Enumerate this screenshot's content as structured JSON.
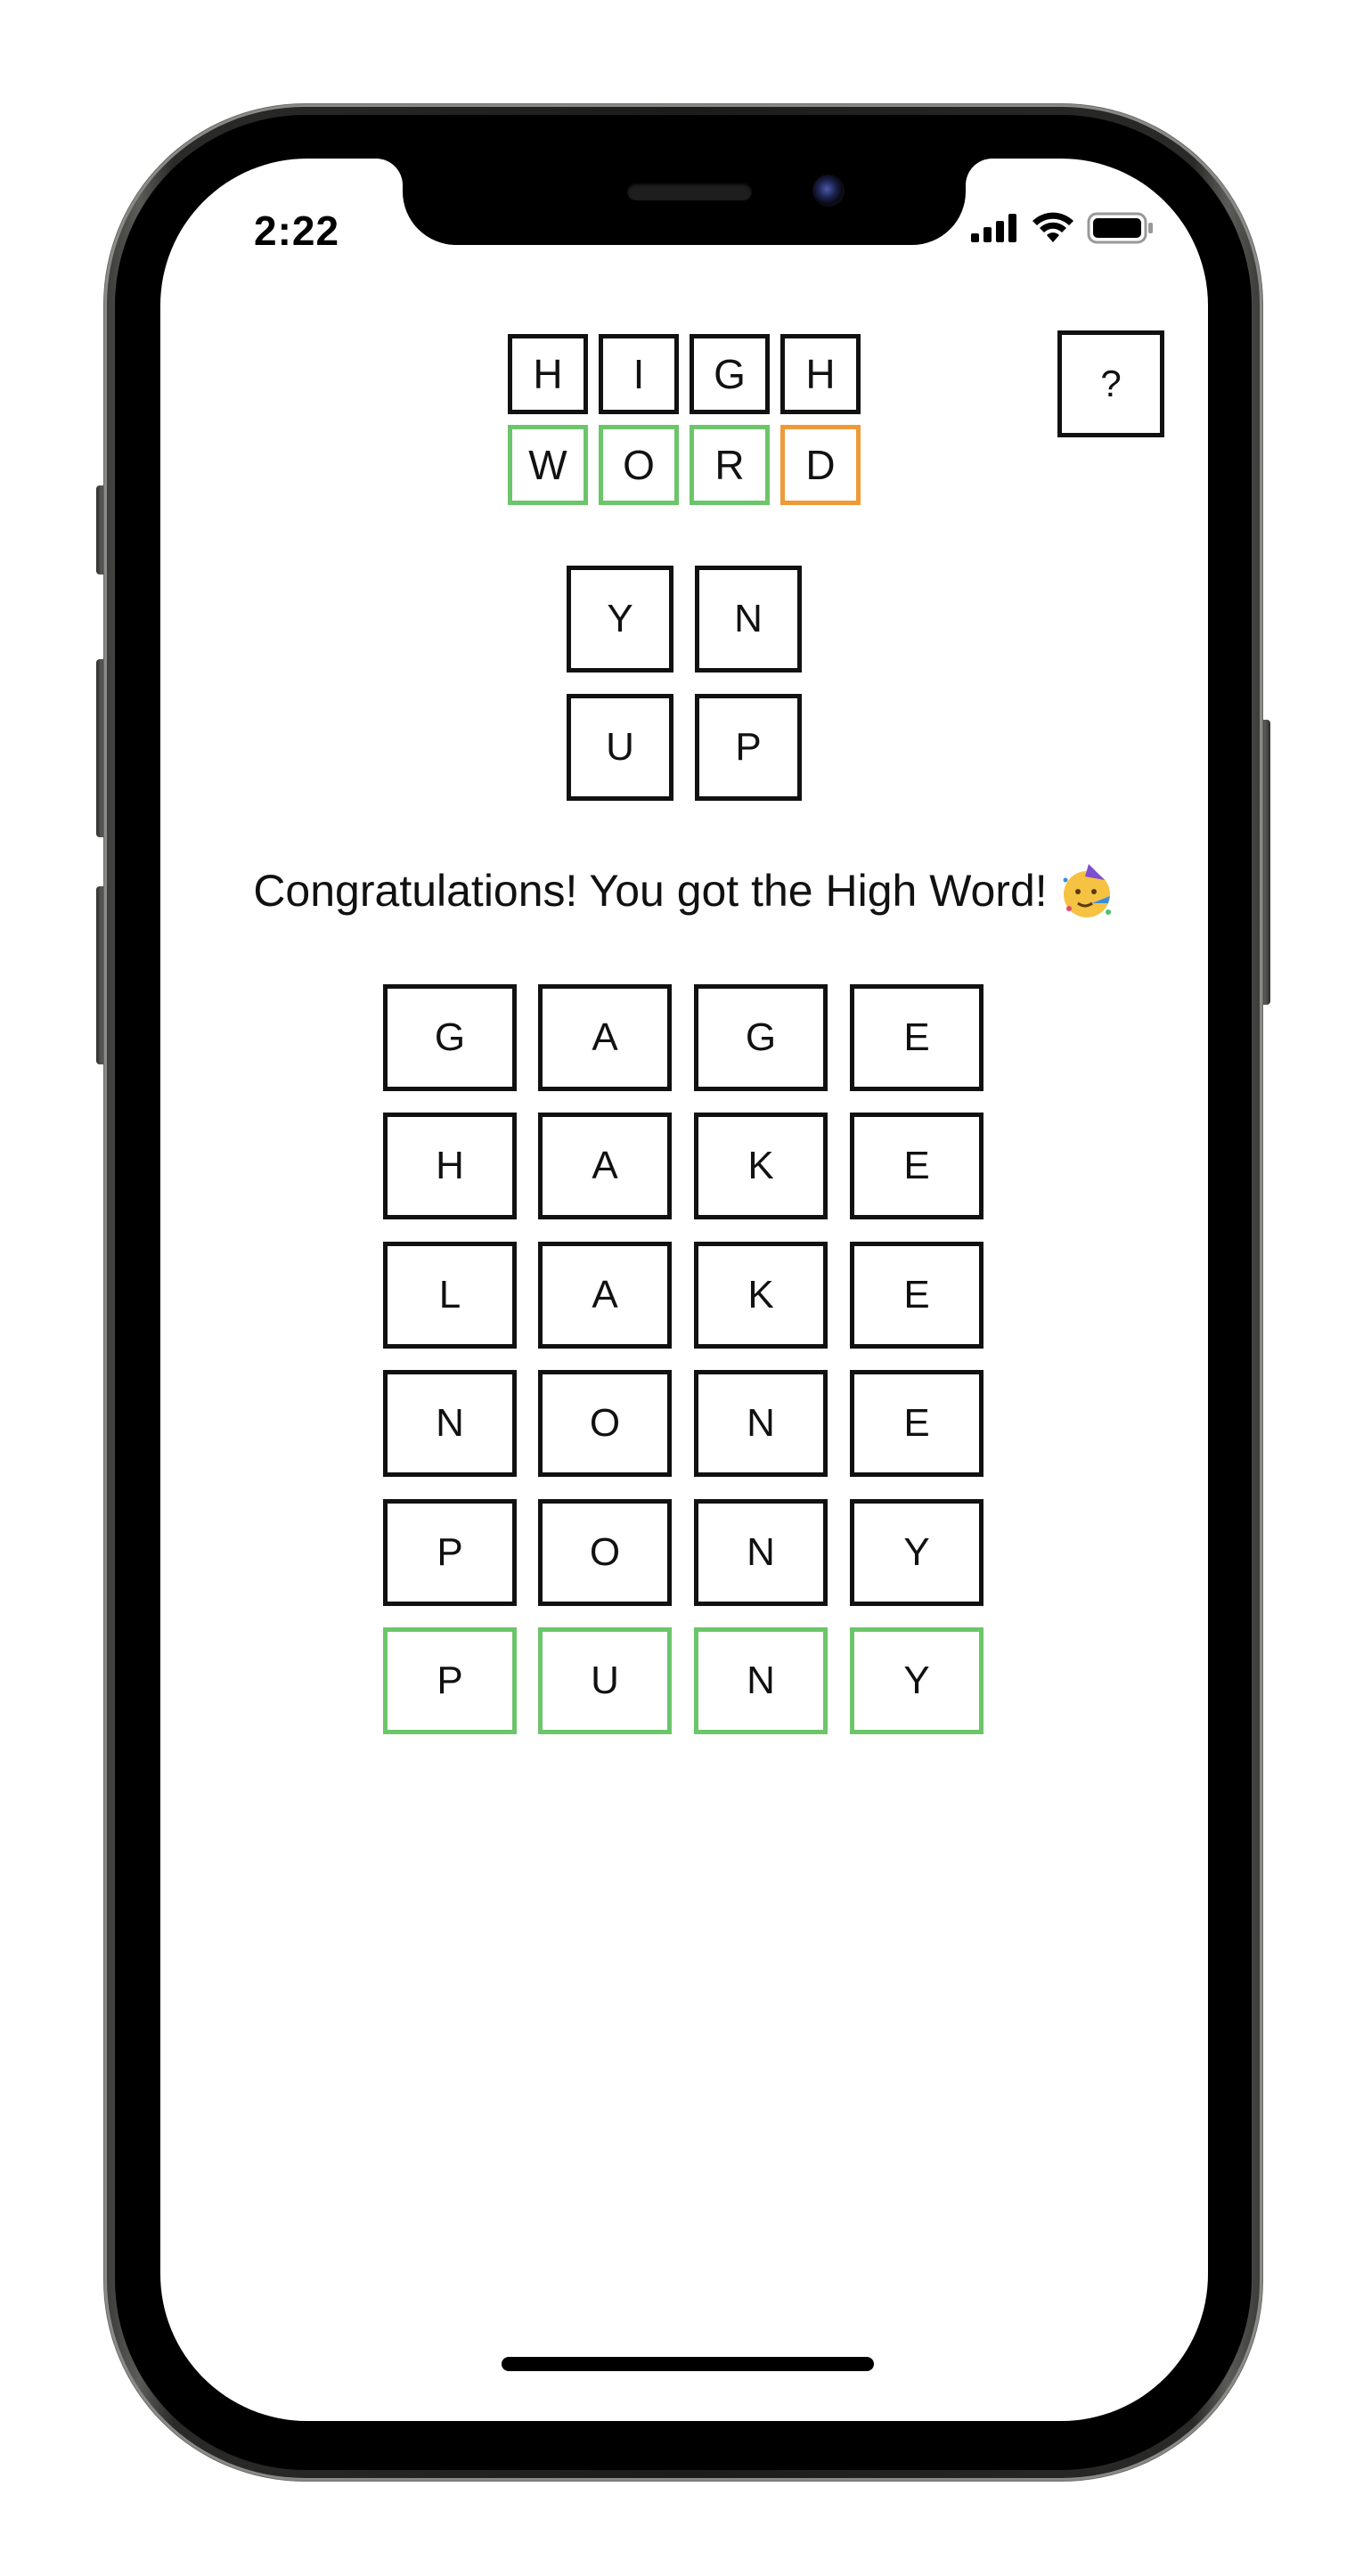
{
  "status_bar": {
    "time": "2:22",
    "icons": [
      "cellular-signal-icon",
      "wifi-icon",
      "battery-icon"
    ]
  },
  "logo": {
    "row1": [
      "H",
      "I",
      "G",
      "H"
    ],
    "row2": [
      {
        "letter": "W",
        "color": "green"
      },
      {
        "letter": "O",
        "color": "green"
      },
      {
        "letter": "R",
        "color": "green"
      },
      {
        "letter": "D",
        "color": "orange"
      }
    ]
  },
  "help_button": {
    "label": "?"
  },
  "key_grid": {
    "rows": [
      [
        "Y",
        "N"
      ],
      [
        "U",
        "P"
      ]
    ]
  },
  "message": {
    "text": "Congratulations! You got the High Word!",
    "emoji": "party-face-icon"
  },
  "guesses": {
    "rows": [
      {
        "letters": [
          "G",
          "A",
          "G",
          "E"
        ],
        "state": "default"
      },
      {
        "letters": [
          "H",
          "A",
          "K",
          "E"
        ],
        "state": "default"
      },
      {
        "letters": [
          "L",
          "A",
          "K",
          "E"
        ],
        "state": "default"
      },
      {
        "letters": [
          "N",
          "O",
          "N",
          "E"
        ],
        "state": "default"
      },
      {
        "letters": [
          "P",
          "O",
          "N",
          "Y"
        ],
        "state": "default"
      },
      {
        "letters": [
          "P",
          "U",
          "N",
          "Y"
        ],
        "state": "correct"
      }
    ]
  },
  "colors": {
    "green": "#6cc56a",
    "orange": "#ef9a37",
    "border": "#111111"
  }
}
